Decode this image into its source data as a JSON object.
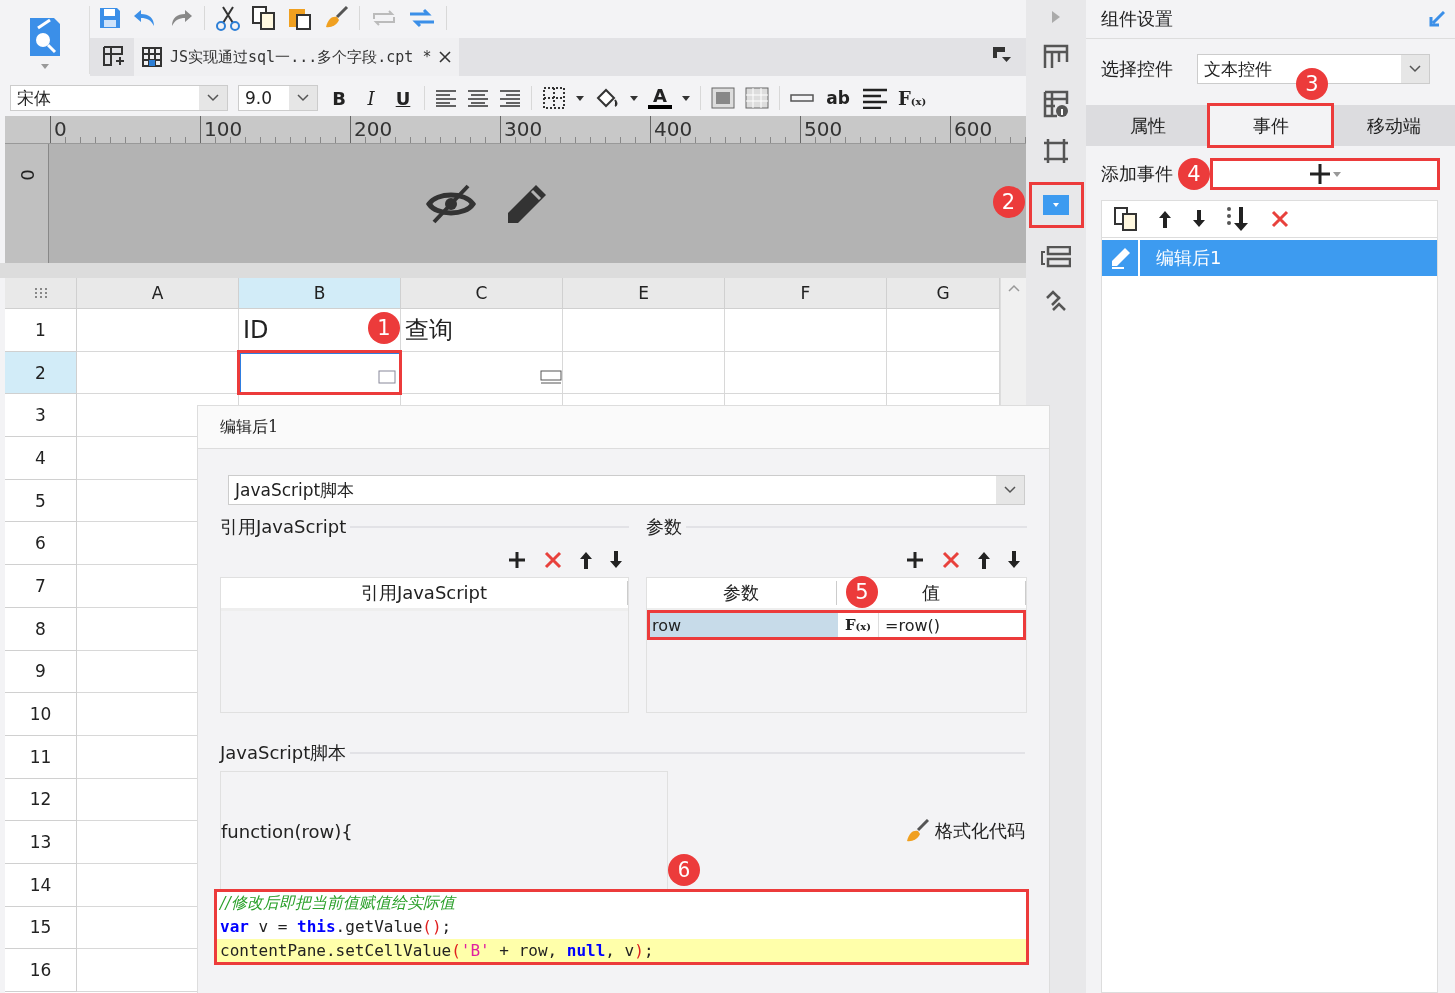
{
  "document_tab": {
    "title": "JS实现通过sql一...多个字段.cpt *"
  },
  "format_bar": {
    "font": "宋体",
    "size": "9.0",
    "style_buttons": [
      {
        "label": "B",
        "kind": "bold"
      },
      {
        "label": "I",
        "kind": "italic"
      },
      {
        "label": "U",
        "kind": "underline"
      }
    ],
    "font_color_label": "A",
    "wrap_label": "ab",
    "formula_label": "F",
    "formula_sub": "(x)"
  },
  "ruler": {
    "ticks": [
      "0",
      "100",
      "200",
      "300",
      "400",
      "500",
      "600"
    ],
    "vertical_tick": "0"
  },
  "sheet": {
    "columns": [
      {
        "label": "A",
        "selected": false
      },
      {
        "label": "B",
        "selected": true
      },
      {
        "label": "C",
        "selected": false
      },
      {
        "label": "E",
        "selected": false
      },
      {
        "label": "F",
        "selected": false
      },
      {
        "label": "G",
        "selected": false
      }
    ],
    "rows": [
      {
        "label": "1",
        "selected": false,
        "cells": [
          {
            "kind": "empty"
          },
          {
            "kind": "text",
            "text": "ID",
            "callout": "1"
          },
          {
            "kind": "text",
            "text": "查询"
          },
          {
            "kind": "empty"
          },
          {
            "kind": "empty"
          },
          {
            "kind": "empty"
          }
        ]
      },
      {
        "label": "2",
        "selected": true,
        "cells": [
          {
            "kind": "empty"
          },
          {
            "kind": "text-widget",
            "outlined": true
          },
          {
            "kind": "button-widget"
          },
          {
            "kind": "empty"
          },
          {
            "kind": "empty"
          },
          {
            "kind": "empty"
          }
        ]
      },
      {
        "label": "3",
        "selected": false
      },
      {
        "label": "4",
        "selected": false
      },
      {
        "label": "5",
        "selected": false
      },
      {
        "label": "6",
        "selected": false
      },
      {
        "label": "7",
        "selected": false
      },
      {
        "label": "8",
        "selected": false
      },
      {
        "label": "9",
        "selected": false
      },
      {
        "label": "10",
        "selected": false
      },
      {
        "label": "11",
        "selected": false
      },
      {
        "label": "12",
        "selected": false
      },
      {
        "label": "13",
        "selected": false
      },
      {
        "label": "14",
        "selected": false
      },
      {
        "label": "15",
        "selected": false
      },
      {
        "label": "16",
        "selected": false
      }
    ]
  },
  "side_strip": {
    "callout": "2"
  },
  "dialog": {
    "title": "编辑后1",
    "type_value": "JavaScript脚本",
    "ref_section": "引用JavaScript",
    "ref_column": "引用JavaScript",
    "param_section": "参数",
    "param_columns": [
      "参数",
      "值"
    ],
    "params": [
      {
        "name": "row",
        "formula_label": "F",
        "formula_sub": "(x)",
        "value": "=row()",
        "selected": true,
        "callout": "5"
      }
    ],
    "script_section": "JavaScript脚本",
    "function_header": "function(row){",
    "format_button": "格式化代码",
    "code_callout": "6",
    "code_lines": [
      {
        "highlighted": false,
        "tokens": [
          {
            "kind": "comment",
            "text": "//修改后即把当前值赋值给实际值"
          }
        ]
      },
      {
        "highlighted": false,
        "tokens": [
          {
            "kind": "keyword",
            "text": "var"
          },
          {
            "kind": "plain",
            "text": " v = "
          },
          {
            "kind": "keyword",
            "text": "this"
          },
          {
            "kind": "plain",
            "text": ".getValue"
          },
          {
            "kind": "paren",
            "text": "()"
          },
          {
            "kind": "plain",
            "text": ";"
          }
        ]
      },
      {
        "highlighted": true,
        "tokens": [
          {
            "kind": "plain",
            "text": "contentPane.setCellValue"
          },
          {
            "kind": "paren",
            "text": "("
          },
          {
            "kind": "string",
            "text": "'B'"
          },
          {
            "kind": "plain",
            "text": " + row, "
          },
          {
            "kind": "keyword",
            "text": "null"
          },
          {
            "kind": "plain",
            "text": ", v"
          },
          {
            "kind": "paren",
            "text": ")"
          },
          {
            "kind": "plain",
            "text": ";"
          }
        ]
      }
    ]
  },
  "panel": {
    "title": "组件设置",
    "select_label": "选择控件",
    "select_value": "文本控件",
    "tabs": [
      {
        "label": "属性",
        "selected": false
      },
      {
        "label": "事件",
        "selected": true,
        "callout": "3"
      },
      {
        "label": "移动端",
        "selected": false
      }
    ],
    "add_event_label": "添加事件",
    "add_event_callout": "4",
    "events": [
      {
        "name": "编辑后1",
        "selected": true
      }
    ]
  }
}
